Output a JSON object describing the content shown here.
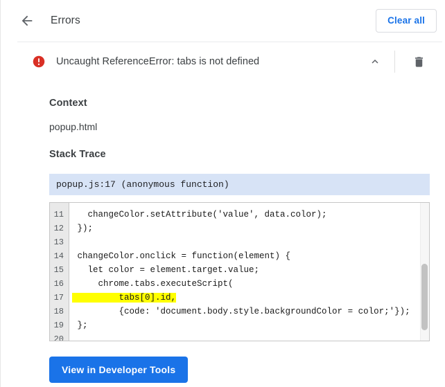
{
  "header": {
    "back_icon": "arrow-left-icon",
    "title": "Errors",
    "clear_all_label": "Clear all"
  },
  "error": {
    "severity_icon": "error-circle-icon",
    "message": "Uncaught ReferenceError: tabs is not defined",
    "collapse_icon": "chevron-up-icon",
    "delete_icon": "trash-icon"
  },
  "detail": {
    "context_heading": "Context",
    "context_value": "popup.html",
    "stack_heading": "Stack Trace",
    "stack_frame": "popup.js:17 (anonymous function)"
  },
  "code": {
    "line_numbers": [
      "11",
      "12",
      "13",
      "14",
      "15",
      "16",
      "17",
      "18",
      "19",
      "20"
    ],
    "lines": [
      {
        "num": "11",
        "text": "   changeColor.setAttribute('value', data.color);",
        "highlight": false
      },
      {
        "num": "12",
        "text": " });",
        "highlight": false
      },
      {
        "num": "13",
        "text": "",
        "highlight": false
      },
      {
        "num": "14",
        "text": " changeColor.onclick = function(element) {",
        "highlight": false
      },
      {
        "num": "15",
        "text": "   let color = element.target.value;",
        "highlight": false
      },
      {
        "num": "16",
        "text": "     chrome.tabs.executeScript(",
        "highlight": false
      },
      {
        "num": "17",
        "text": "         tabs[0].id,",
        "highlight": true
      },
      {
        "num": "18",
        "text": "         {code: 'document.body.style.backgroundColor = color;'});",
        "highlight": false
      },
      {
        "num": "19",
        "text": " };",
        "highlight": false
      },
      {
        "num": "20",
        "text": "",
        "highlight": false
      }
    ],
    "highlight_color": "#ffff00",
    "gutter_color": "#e9e9e9"
  },
  "footer": {
    "devtools_label": "View in Developer Tools"
  },
  "colors": {
    "accent_blue": "#1a73e8",
    "error_red": "#d93025",
    "stack_band_blue": "#d7e3f6",
    "text_primary": "#3c4043"
  }
}
